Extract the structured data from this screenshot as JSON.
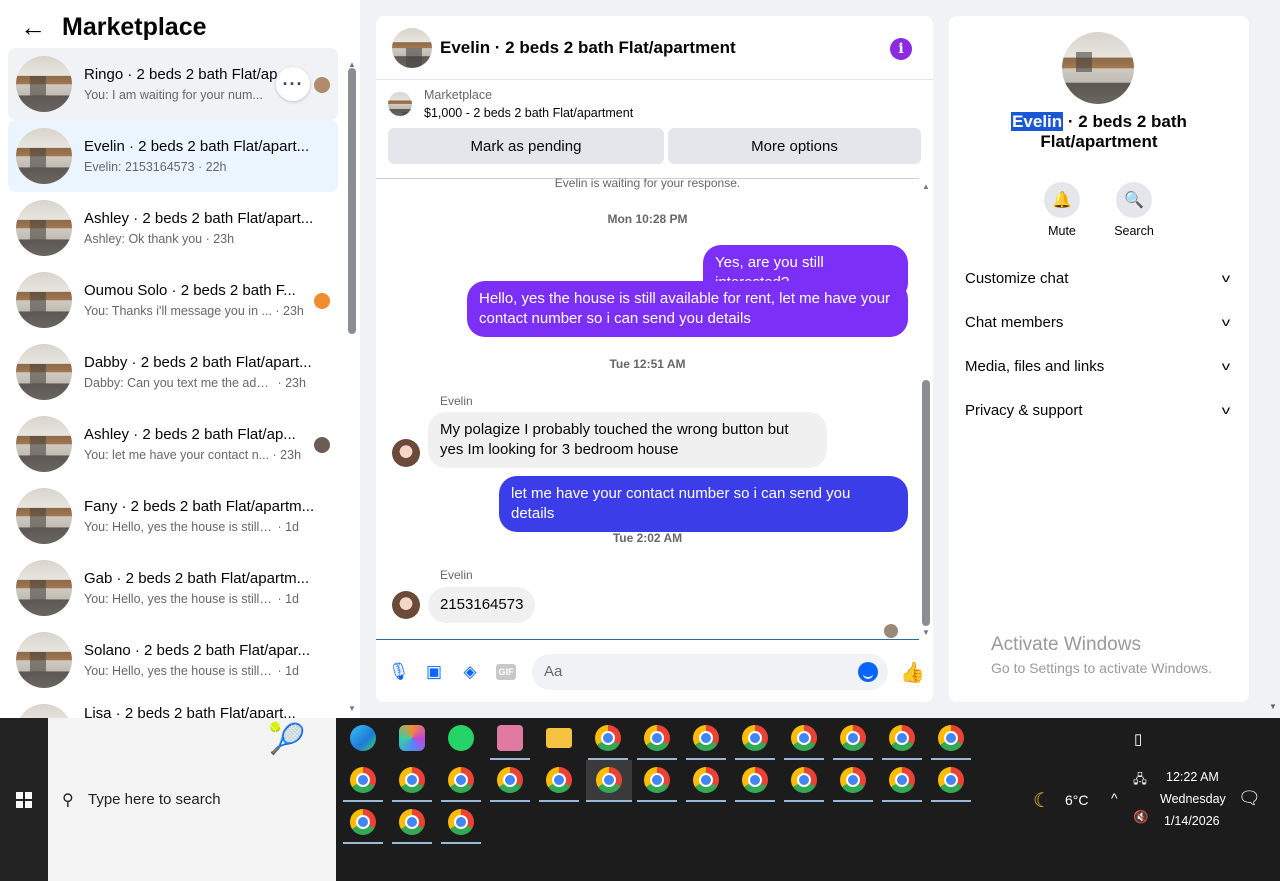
{
  "left_panel": {
    "title": "Marketplace",
    "conversations": [
      {
        "name": "Ringo · 2 beds 2 bath Flat/ap",
        "preview": "You: I am waiting for your num...",
        "time": ""
      },
      {
        "name": "Evelin · 2 beds 2 bath Flat/apart...",
        "preview": "Evelin: 2153164573",
        "time": " · 22h"
      },
      {
        "name": "Ashley · 2 beds 2 bath Flat/apart...",
        "preview": "Ashley: Ok thank you",
        "time": " · 23h"
      },
      {
        "name": "Oumou Solo · 2 beds 2 bath F...",
        "preview": "You: Thanks i'll message you in ...",
        "time": " · 23h"
      },
      {
        "name": "Dabby · 2 beds 2 bath Flat/apart...",
        "preview": "Dabby: Can you text me the addre...",
        "time": " · 23h"
      },
      {
        "name": "Ashley · 2 beds 2 bath Flat/ap...",
        "preview": "You: let me have your contact n...",
        "time": " · 23h"
      },
      {
        "name": "Fany · 2 beds 2 bath Flat/apartm...",
        "preview": "You: Hello, yes the house is still ava...",
        "time": " · 1d"
      },
      {
        "name": "Gab · 2 beds 2 bath Flat/apartm...",
        "preview": "You: Hello, yes the house is still ava...",
        "time": " · 1d"
      },
      {
        "name": "Solano · 2 beds 2 bath Flat/apar...",
        "preview": "You: Hello, yes the house is still ava...",
        "time": " · 1d"
      },
      {
        "name": "Lisa · 2 beds 2 bath Flat/apart...",
        "preview": "",
        "time": ""
      }
    ]
  },
  "chat": {
    "title": "Evelin · 2 beds 2 bath Flat/apartment",
    "marketplace_label": "Marketplace",
    "listing": "$1,000 - 2 beds 2 bath Flat/apartment",
    "mark_pending": "Mark as pending",
    "more_options": "More options",
    "system_msg": "Evelin is waiting for your response.",
    "ts1": "Mon 10:28 PM",
    "out1": "Yes, are you still interested?",
    "out2": "Hello, yes the house is still available for rent, let me have your contact number so i can send you details",
    "ts2": "Tue 12:51 AM",
    "sender1": "Evelin",
    "in1": "My polagize I probably touched the wrong button but yes Im looking for 3 bedroom house",
    "out3": "let me have your contact number so i can send you details",
    "ts3": "Tue 2:02 AM",
    "sender2": "Evelin",
    "in2": "2153164573",
    "input_placeholder": "Aa",
    "gif_label": "GIF"
  },
  "right_panel": {
    "name_highlight": "Evelin",
    "name_rest": " · 2 beds 2 bath",
    "name_line2": "Flat/apartment",
    "mute": "Mute",
    "search": "Search",
    "sections": [
      "Customize chat",
      "Chat members",
      "Media, files and links",
      "Privacy & support"
    ],
    "watermark_title": "Activate Windows",
    "watermark_sub": "Go to Settings to activate Windows."
  },
  "taskbar": {
    "search_placeholder": "Type here to search",
    "weather": "6°C",
    "time": "12:22 AM",
    "day": "Wednesday",
    "date": "1/14/2026"
  },
  "colors": {
    "accent_purple": "#7b2ff7",
    "accent_blue": "#3b3de8",
    "selected_bg": "#ebf5ff",
    "brand": "#0866ff"
  }
}
